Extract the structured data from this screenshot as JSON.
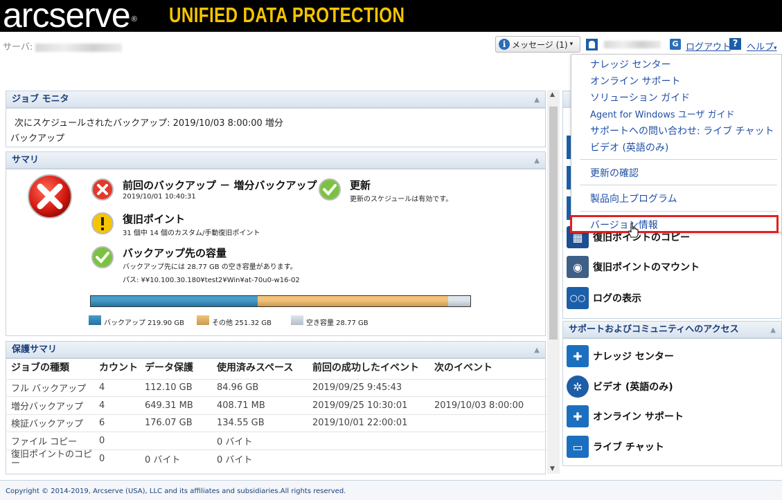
{
  "header": {
    "brand": "arcserve",
    "brand_mark": "®",
    "product": "UNIFIED DATA PROTECTION",
    "server_label": "サーバ:",
    "message_button": "メッセージ (1)",
    "logout": "ログアウト",
    "help": "ヘルプ"
  },
  "job_monitor": {
    "title": "ジョブ モニタ",
    "line1": "次にスケジュールされたバックアップ: 2019/10/03 8:00:00 増分",
    "line2": "バックアップ"
  },
  "summary": {
    "title": "サマリ",
    "last_backup": {
      "title": "前回のバックアップ － 増分バックアップ",
      "sub": "2019/10/01 10:40:31"
    },
    "update": {
      "title": "更新",
      "sub": "更新のスケジュールは有効です。"
    },
    "recovery_points": {
      "title": "復旧ポイント",
      "sub": "31 個中 14 個のカスタム/手動復旧ポイント"
    },
    "capacity": {
      "title": "バックアップ先の容量",
      "sub1": "バックアップ先には 28.77 GB の空き容量があります。",
      "sub2": "パス: ¥¥10.100.30.180¥test2¥Win¥at-70u0-w16-02"
    },
    "storage_bar": [
      {
        "name": "バックアップ 219.90 GB",
        "value_gb": 219.9,
        "color": "#4a9cc8"
      },
      {
        "name": "その他 251.32 GB",
        "value_gb": 251.32,
        "color": "#f2c27a"
      },
      {
        "name": "空き容量 28.77 GB",
        "value_gb": 28.77,
        "color": "#dde6ee"
      }
    ]
  },
  "protection": {
    "title": "保護サマリ",
    "columns": [
      "ジョブの種類",
      "カウント",
      "データ保護",
      "使用済みスペース",
      "前回の成功したイベント",
      "次のイベント"
    ],
    "rows": [
      [
        "フル バックアップ",
        "4",
        "112.10 GB",
        "84.96 GB",
        "2019/09/25 9:45:43",
        ""
      ],
      [
        "増分バックアップ",
        "4",
        "649.31 MB",
        "408.71 MB",
        "2019/09/25 10:30:01",
        "2019/10/03 8:00:00"
      ],
      [
        "検証バックアップ",
        "6",
        "176.07 GB",
        "134.55 GB",
        "2019/10/01 22:00:01",
        ""
      ],
      [
        "ファイル コピー",
        "0",
        "",
        "0 バイト",
        "",
        ""
      ],
      [
        "復旧ポイントのコピー",
        "0",
        "0 バイト",
        "0 バイト",
        "",
        ""
      ]
    ]
  },
  "tasks": {
    "copy_rp": "復旧ポイントのコピー",
    "mount_rp": "復旧ポイントのマウント",
    "view_logs": "ログの表示"
  },
  "support": {
    "title": "サポートおよびコミュニティへのアクセス",
    "items": [
      "ナレッジ センター",
      "ビデオ (英語のみ)",
      "オンライン サポート",
      "ライブ チャット"
    ]
  },
  "help_menu": {
    "items": [
      "ナレッジ センター",
      "オンライン サポート",
      "ソリューション ガイド",
      "Agent for Windows ユーザ ガイド",
      "サポートへの問い合わせ: ライブ チャット",
      "ビデオ (英語のみ)",
      "更新の確認",
      "製品向上プログラム",
      "バージョン情報"
    ]
  },
  "footer": "Copyright © 2014-2019, Arcserve (USA), LLC and its affiliates and subsidiaries.All rights reserved."
}
